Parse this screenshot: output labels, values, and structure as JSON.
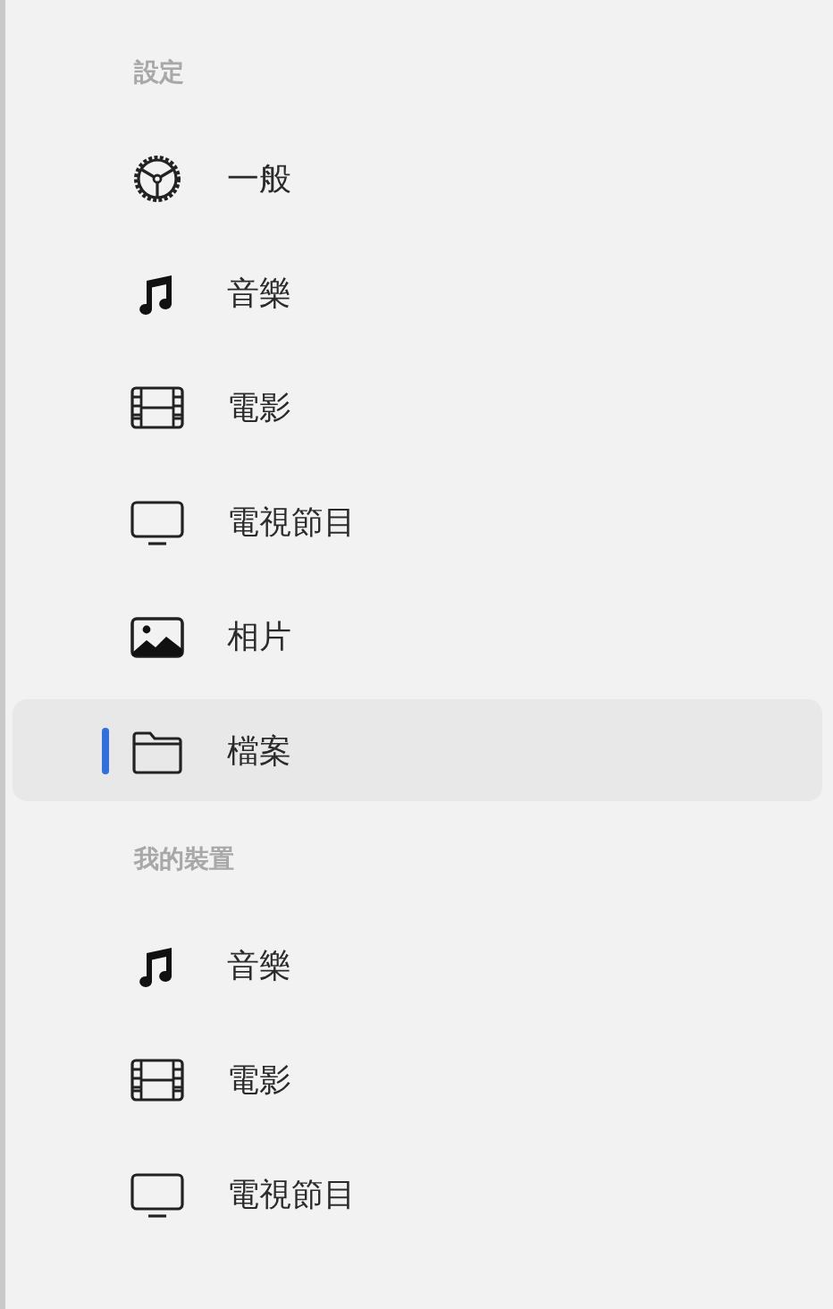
{
  "sections": [
    {
      "title": "設定",
      "items": [
        {
          "kind": "gear",
          "label": "一般",
          "selected": false
        },
        {
          "kind": "music",
          "label": "音樂",
          "selected": false
        },
        {
          "kind": "film",
          "label": "電影",
          "selected": false
        },
        {
          "kind": "tv",
          "label": "電視節目",
          "selected": false
        },
        {
          "kind": "photo",
          "label": "相片",
          "selected": false
        },
        {
          "kind": "folder",
          "label": "檔案",
          "selected": true
        }
      ]
    },
    {
      "title": "我的裝置",
      "items": [
        {
          "kind": "music",
          "label": "音樂",
          "selected": false
        },
        {
          "kind": "film",
          "label": "電影",
          "selected": false
        },
        {
          "kind": "tv",
          "label": "電視節目",
          "selected": false
        }
      ]
    }
  ]
}
